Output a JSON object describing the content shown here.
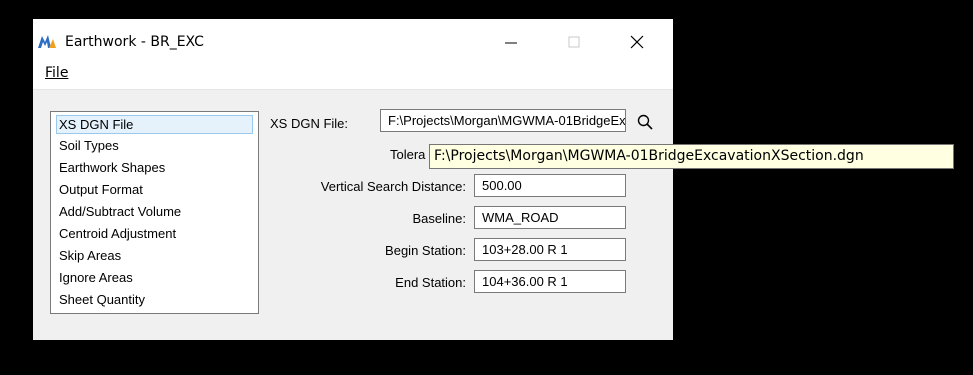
{
  "window": {
    "title": "Earthwork - BR_EXC"
  },
  "menu": {
    "file_label": "File"
  },
  "categories": [
    "XS DGN File",
    "Soil Types",
    "Earthwork Shapes",
    "Output Format",
    "Add/Subtract Volume",
    "Centroid Adjustment",
    "Skip Areas",
    "Ignore Areas",
    "Sheet Quantity"
  ],
  "selected_category": "XS DGN File",
  "form": {
    "xs_dgn_file_label": "XS DGN File:",
    "xs_dgn_file_value": "F:\\Projects\\Morgan\\MGWMA-01BridgeExcavationXSection.dgn",
    "tolerance_label": "Tolera",
    "vertical_search_label": "Vertical Search Distance:",
    "vertical_search_value": "500.00",
    "baseline_label": "Baseline:",
    "baseline_value": "WMA_ROAD",
    "begin_station_label": "Begin Station:",
    "begin_station_value": "103+28.00 R 1",
    "end_station_label": "End Station:",
    "end_station_value": "104+36.00 R 1"
  },
  "tooltip": {
    "text": "F:\\Projects\\Morgan\\MGWMA-01BridgeExcavationXSection.dgn"
  },
  "colors": {
    "tooltip_bg": "#ffffe1",
    "selection_bg": "#e5f1fb",
    "icon_blue": "#2b6cc4",
    "icon_orange": "#f0a020"
  }
}
